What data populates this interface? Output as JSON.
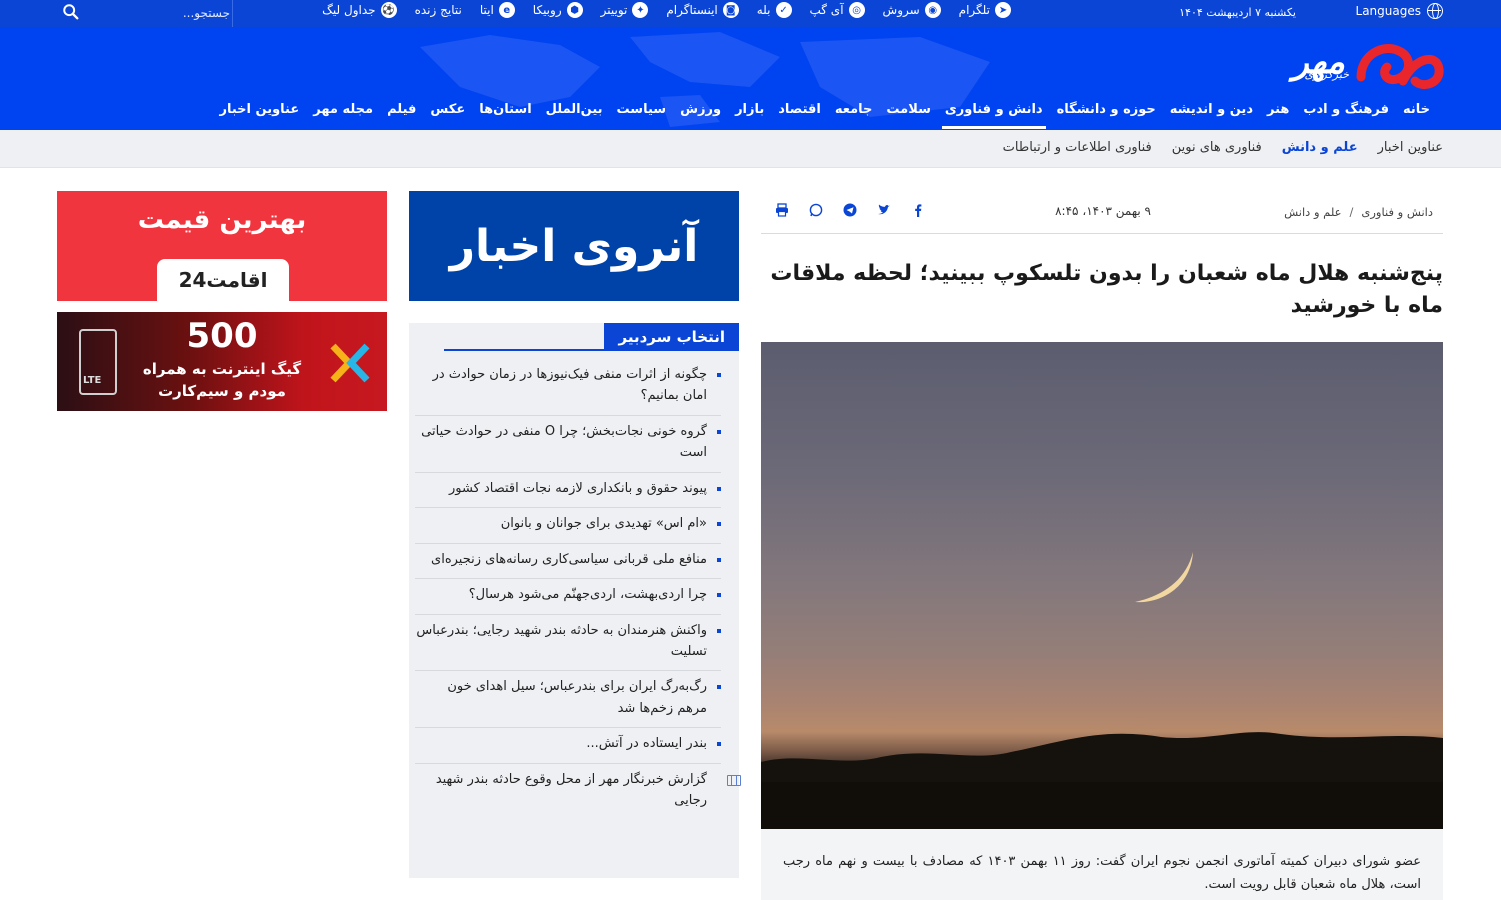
{
  "topbar": {
    "languages_label": "Languages",
    "date": "یکشنبه ۷ اردیبهشت ۱۴۰۴",
    "social": [
      {
        "label": "تلگرام",
        "icon": "telegram-icon",
        "glyph": "➤"
      },
      {
        "label": "سروش",
        "icon": "soroush-icon",
        "glyph": "◉"
      },
      {
        "label": "آی گپ",
        "icon": "igap-icon",
        "glyph": "◎"
      },
      {
        "label": "بله",
        "icon": "bale-icon",
        "glyph": "✓"
      },
      {
        "label": "اینستاگرام",
        "icon": "instagram-icon",
        "glyph": "◙"
      },
      {
        "label": "توییتر",
        "icon": "twitter-icon",
        "glyph": "✦"
      },
      {
        "label": "روبیکا",
        "icon": "rubika-icon",
        "glyph": "⬢"
      },
      {
        "label": "ایتا",
        "icon": "eitaa-icon",
        "glyph": "e"
      },
      {
        "label": "نتایج زنده",
        "icon": "",
        "glyph": ""
      },
      {
        "label": "جداول لیگ",
        "icon": "football-icon",
        "glyph": "⚽"
      }
    ],
    "search_placeholder": "جستجو..."
  },
  "logo": {
    "brand": "مهر",
    "subtitle": "خبرگزاری"
  },
  "main_nav": [
    {
      "label": "خانه",
      "active": false
    },
    {
      "label": "فرهنگ و ادب",
      "active": false
    },
    {
      "label": "هنر",
      "active": false
    },
    {
      "label": "دین و اندیشه",
      "active": false
    },
    {
      "label": "حوزه و دانشگاه",
      "active": false
    },
    {
      "label": "دانش و فناوری",
      "active": true
    },
    {
      "label": "سلامت",
      "active": false
    },
    {
      "label": "جامعه",
      "active": false
    },
    {
      "label": "اقتصاد",
      "active": false
    },
    {
      "label": "بازار",
      "active": false
    },
    {
      "label": "ورزش",
      "active": false
    },
    {
      "label": "سیاست",
      "active": false
    },
    {
      "label": "بین‌الملل",
      "active": false
    },
    {
      "label": "استان‌ها",
      "active": false
    },
    {
      "label": "عکس",
      "active": false
    },
    {
      "label": "فیلم",
      "active": false
    },
    {
      "label": "مجله مهر",
      "active": false
    },
    {
      "label": "عناوین اخبار",
      "active": false
    }
  ],
  "sub_nav": [
    {
      "label": "عناوین اخبار",
      "active": false
    },
    {
      "label": "علم و دانش",
      "active": true
    },
    {
      "label": "فناوری های نوین",
      "active": false
    },
    {
      "label": "فناوری اطلاعات و ارتباطات",
      "active": false
    }
  ],
  "article": {
    "breadcrumb": [
      "دانش و فناوری",
      "علم و دانش"
    ],
    "breadcrumb_separator": "/",
    "date": "۹ بهمن ۱۴۰۳، ۸:۴۵",
    "headline": "پنج‌شنبه هلال ماه شعبان را بدون تلسکوپ ببینید؛ لحظه ملاقات ماه با خورشید",
    "lead": "عضو شورای دبیران کمیته آماتوری انجمن نجوم ایران گفت: روز ۱۱ بهمن ۱۴۰۳ که مصادف با بیست و نهم ماه رجب است، هلال ماه شعبان قابل رویت است."
  },
  "ads": {
    "news_ad_text": "آنروی اخبار",
    "red_ad_text": "بهترین قیمت",
    "red_ad_brand": "اقامت24",
    "sim_ad_number": "500",
    "sim_ad_line1": "گیگ اینترنت به همراه",
    "sim_ad_line2": "مودم و سیم‌کارت",
    "sim_ad_lte": "LTE"
  },
  "editor_pick": {
    "title": "انتخاب سردبیر",
    "items": [
      {
        "text": "چگونه از اثرات منفی فیک‌نیوزها در زمان حوادث در امان بمانیم؟",
        "video": false
      },
      {
        "text": "گروه خونی نجات‌بخش؛ چرا O منفی در حوادث حیاتی است",
        "video": false
      },
      {
        "text": "پیوند حقوق و بانکداری لازمه نجات اقتصاد کشور",
        "video": false
      },
      {
        "text": "«ام اس» تهدیدی برای جوانان و بانوان",
        "video": false
      },
      {
        "text": "منافع ملی قربانی سیاسی‌کاری رسانه‌های زنجیره‌ای",
        "video": false
      },
      {
        "text": "چرا اردی‌بهشت، اردی‌جهنّم می‌شود هرسال؟",
        "video": false
      },
      {
        "text": "واکنش هنرمندان به حادثه بندر شهید رجایی؛ بندرعباس تسلیت",
        "video": false
      },
      {
        "text": "رگ‌به‌رگ ایران برای بندرعباس؛ سیل اهدای خون مرهم زخم‌ها شد",
        "video": false
      },
      {
        "text": "بندر ایستاده در آتش...",
        "video": false
      },
      {
        "text": "گزارش خبرنگار مهر از محل وقوع حادثه بندر شهید رجایی",
        "video": true
      }
    ]
  },
  "colors": {
    "brand_blue": "#0043f0",
    "topbar_blue": "#0a45d6",
    "logo_red": "#e8262c"
  }
}
